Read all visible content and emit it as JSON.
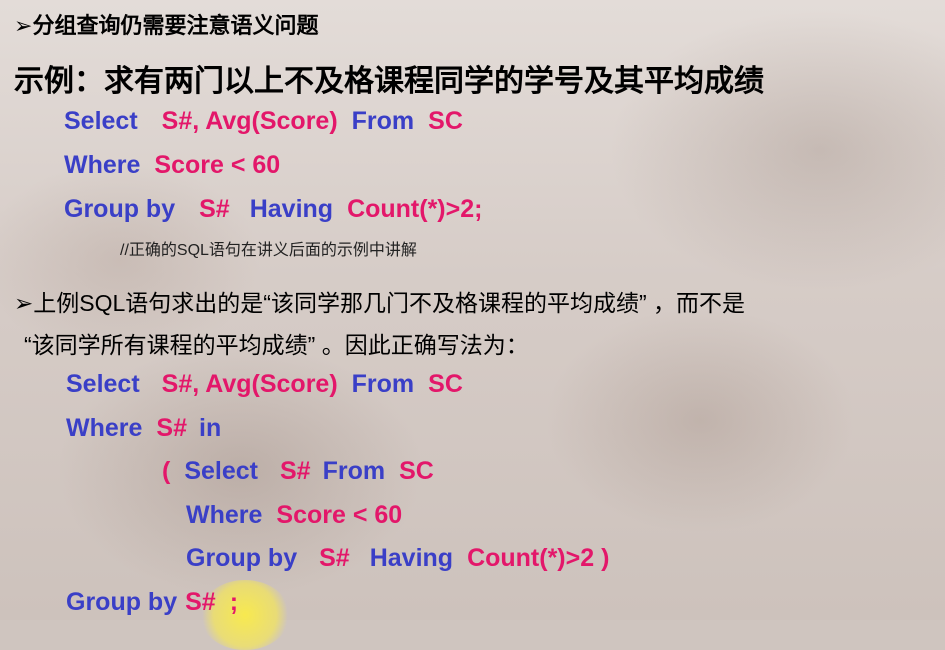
{
  "slide": {
    "bullet1": "分组查询仍需要注意语义问题",
    "bullet_marker": "➢",
    "example_title": "示例：求有两门以上不及格课程同学的学号及其平均成绩",
    "query1": {
      "l1": {
        "kw1": "Select",
        "v1": "S#, Avg(Score)",
        "kw2": "From",
        "v2": "SC"
      },
      "l2": {
        "kw1": "Where",
        "v1": "Score < 60"
      },
      "l3": {
        "kw1": "Group by",
        "v1": "S#",
        "kw2": "Having",
        "v2": "Count(*)>2;"
      }
    },
    "comment": "//正确的SQL语句在讲义后面的示例中讲解",
    "para_line1": "上例SQL语句求出的是“该同学那几门不及格课程的平均成绩” ，而不是",
    "para_line2": "“该同学所有课程的平均成绩” 。因此正确写法为：",
    "query2": {
      "l1": {
        "kw1": "Select",
        "v1": "S#, Avg(Score)",
        "kw2": "From",
        "v2": "SC"
      },
      "l2": {
        "kw1": "Where",
        "v1": "S#",
        "kw2": "in"
      },
      "l3": {
        "p1": "(",
        "kw1": "Select",
        "v1": "S#",
        "kw2": "From",
        "v2": "SC"
      },
      "l4": {
        "kw1": "Where",
        "v1": "Score < 60"
      },
      "l5": {
        "kw1": "Group by",
        "v1": "S#",
        "kw2": "Having",
        "v2": "Count(*)>2 )"
      },
      "l6": {
        "kw1": "Group by",
        "v1": "S#",
        "v2": ";"
      }
    }
  }
}
